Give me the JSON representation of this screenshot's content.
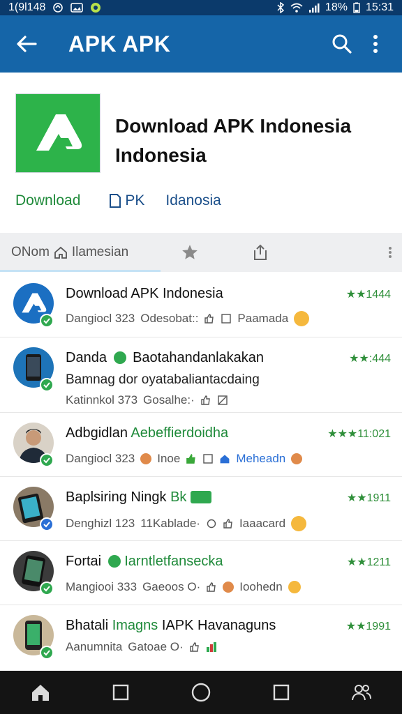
{
  "status_bar": {
    "left_text": "1(9l148",
    "battery": "18%",
    "time": "15:31"
  },
  "app_bar": {
    "title": "APK APK"
  },
  "header": {
    "title": "Download APK Indonesia Indonesia",
    "links": {
      "download": "Download",
      "apk": "PK",
      "indonesia": "Idanosia"
    }
  },
  "tabs": {
    "main_label": "ONom",
    "main_label_2": "Ilamesian"
  },
  "items": [
    {
      "title": "Download APK Indonesia",
      "title_green": "",
      "line2": "",
      "sub_a": "Dangiocl 323",
      "sub_b": "Odesobat::",
      "sub_c": "Paamada",
      "rating": "★★1444"
    },
    {
      "title": "Danda",
      "title_green": "",
      "title_rest": "Baotahandanlakakan",
      "line2": "Bamnag dor oyatabaliantacdaing",
      "sub_a": "Katinnkol 373",
      "sub_b": "Gosalhe:·",
      "sub_c": "",
      "rating": "★★:444"
    },
    {
      "title": "Adbgidlan",
      "title_green": "Aebeffierdoidha",
      "line2": "",
      "sub_a": "Dangiocl 323",
      "sub_b": "Inoe",
      "sub_c": "Meheadn",
      "rating": "★★★11:021"
    },
    {
      "title": "Baplsiring Ningk",
      "title_green": "Bk",
      "line2": "",
      "sub_a": "Denghizl 123",
      "sub_b": "11Kablade·",
      "sub_c": "Iaaacard",
      "rating": "★★1911"
    },
    {
      "title": "Fortai",
      "title_green": "Iarntletfansecka",
      "line2": "",
      "sub_a": "Mangiooi 333",
      "sub_b": "Gaeoos O·",
      "sub_c": "Ioohedn",
      "rating": "★★1211"
    },
    {
      "title": "Bhatali",
      "title_green": "Imagns",
      "title_rest": "IAPK Havanaguns",
      "line2": "",
      "sub_a": "Aanumnita",
      "sub_b": "Gatoae O·",
      "sub_c": "",
      "rating": "★★1991"
    }
  ],
  "colors": {
    "app_bar": "#1565a8",
    "status_bar": "#0b3a6b",
    "brand_green": "#2db34a",
    "link_green": "#1f8a3a",
    "nav_bar": "#141414"
  }
}
